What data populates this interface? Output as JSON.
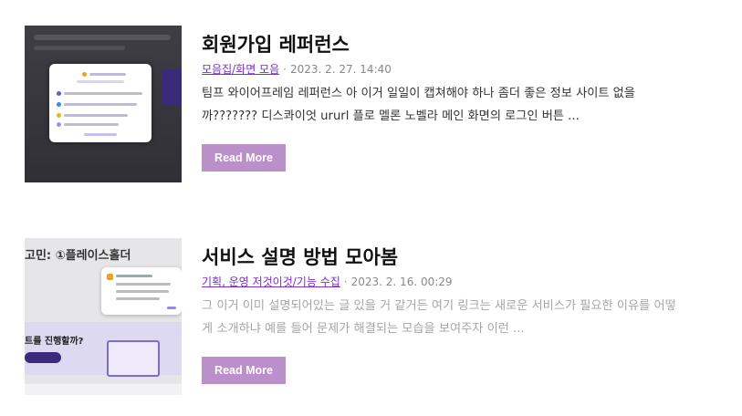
{
  "posts": [
    {
      "title": "회원가입 레퍼런스",
      "category": "모음집/화면 모음",
      "date": "2023. 2. 27. 14:40",
      "excerpt": "팀프 와이어프레임 레퍼런스 아 이거 일일이 캡쳐해야 하나 좀더 좋은 정보 사이트 없을까??????? 디스콰이엇 ururl 플로 멜론 노벨라 메인 화면의 로그인 버튼 ...",
      "button": "Read More",
      "thumb_icon": "signup-modal-thumbnail"
    },
    {
      "title": "서비스 설명 방법 모아봄",
      "category": "기획, 운영 저것이것/기능 수집",
      "date": "2023. 2. 16. 00:29",
      "excerpt": "그 이거 이미 설명되어있는 글 있을 거 같거든 여기 링크는 새로운 서비스가 필요한 이유를 어떻게 소개하냐 예를 들어 문제가 해결되는 모습을 보여주자 이런 ...",
      "button": "Read More",
      "thumb_icon": "service-explanation-thumbnail",
      "thumb_heading": "고민: ①플레이스홀더",
      "thumb_caption": "트를 진행할까?"
    }
  ],
  "separator": "·",
  "colors": {
    "button_bg": "#bb8fc9",
    "link": "#7a2fd0"
  }
}
